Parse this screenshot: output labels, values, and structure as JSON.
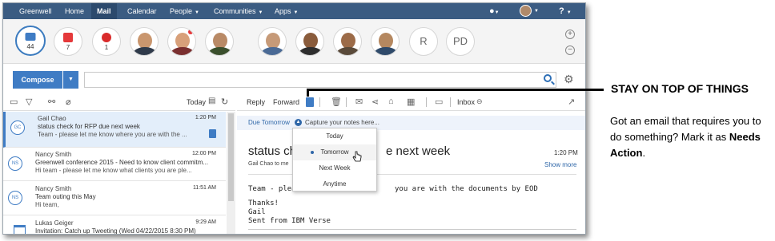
{
  "nav": {
    "brand": "Greenwell",
    "home": "Home",
    "mail": "Mail",
    "calendar": "Calendar",
    "people": "People",
    "communities": "Communities",
    "apps": "Apps",
    "help": "?"
  },
  "bubbles": {
    "mail_count": "44",
    "todo_count": "7",
    "alert_count": "1",
    "initials_1": "R",
    "initials_2": "PD"
  },
  "colors": {
    "nav_bg": "#3b5c82",
    "accent": "#3f7cc4",
    "todo": "#e5393b",
    "alert": "#d92b2b"
  },
  "compose": {
    "label": "Compose"
  },
  "list_toolbar": {
    "today": "Today"
  },
  "messages": [
    {
      "initials": "GC",
      "from": "Gail Chao",
      "subject": "status check for RFP due next week",
      "preview": "Team - please let me know where you are with the ...",
      "time": "1:20 PM"
    },
    {
      "initials": "NS",
      "from": "Nancy Smith",
      "subject": "Greenwell conference 2015 - Need to know client commitm...",
      "preview": "Hi team - please let me know what clients you are ple...",
      "time": "12:00 PM"
    },
    {
      "initials": "NS",
      "from": "Nancy Smith",
      "subject": "Team outing this May",
      "preview": "Hi team,",
      "time": "11:51 AM"
    },
    {
      "initials": "",
      "from": "Lukas Geiger",
      "subject": "Invitation: Catch up Tweeting (Wed 04/22/2015 8:30 PM)",
      "preview": "",
      "time": "9:29 AM"
    }
  ],
  "read_toolbar": {
    "reply": "Reply",
    "forward": "Forward",
    "inbox": "Inbox"
  },
  "due": {
    "label": "Due Tomorrow",
    "notes_placeholder": "Capture your notes here..."
  },
  "dropdown": {
    "items": [
      "Today",
      "Tomorrow",
      "Next Week",
      "Anytime"
    ],
    "selected": "Tomorrow"
  },
  "reading": {
    "subject_start": "status ch",
    "subject_end": "e next week",
    "to_line": "Gail Chao to me",
    "time": "1:20 PM",
    "show_more": "Show more",
    "body_start": "Team - please",
    "body_end": "you are with the documents by EOD",
    "sig_1": "Thanks!",
    "sig_2": "Gail",
    "sig_3": "Sent from IBM Verse"
  },
  "callout": {
    "title": "STAY ON TOP OF THINGS",
    "text_lead": "Got an email that requires you to do something? Mark it as ",
    "text_bold": "Needs Action",
    "text_end": "."
  }
}
